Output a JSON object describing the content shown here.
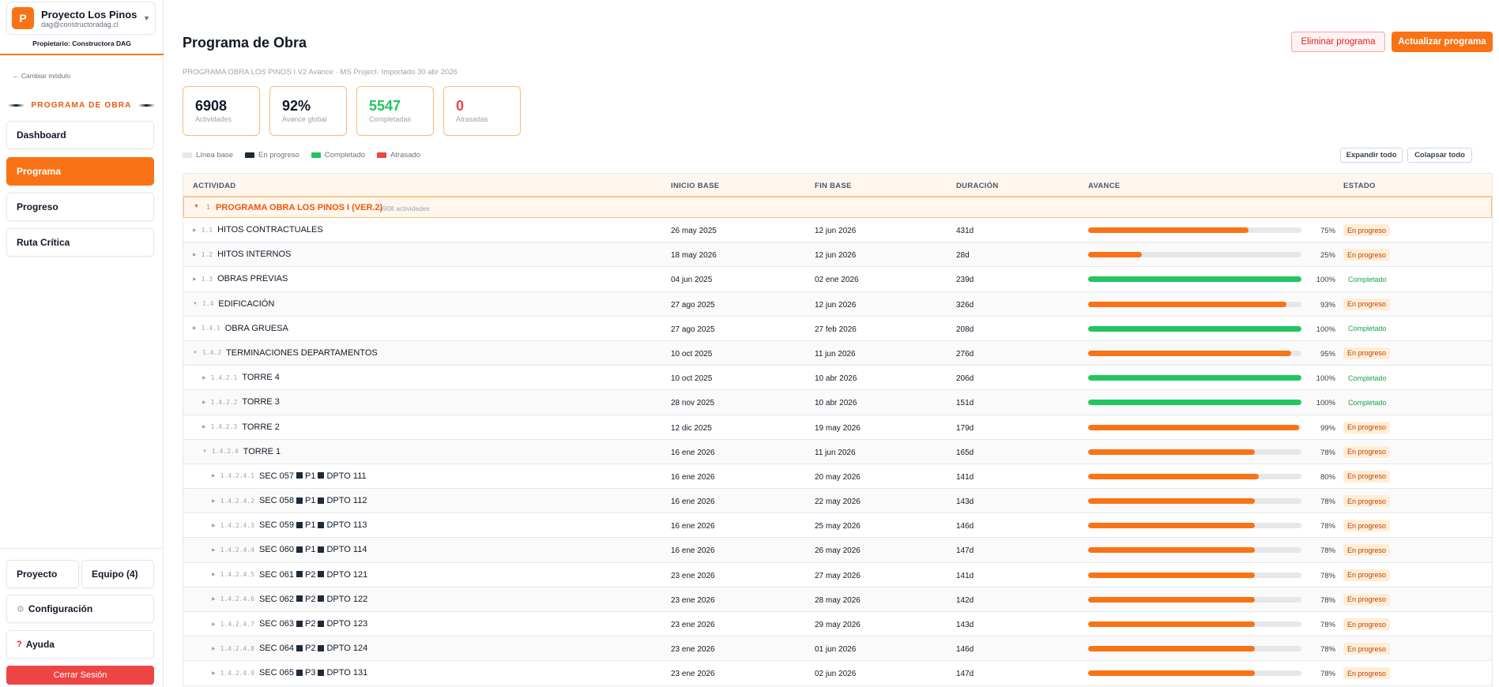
{
  "sidebar": {
    "project_initial": "P",
    "project_name": "Proyecto Los Pinos",
    "project_email": "dag@constructoradag.cl",
    "owner": "Propietario: Constructora DAG",
    "change_module": "← Cambiar módulo",
    "module_title": "PROGRAMA DE OBRA",
    "nav": [
      "Dashboard",
      "Programa",
      "Progreso",
      "Ruta Crítica"
    ],
    "proyecto": "Proyecto",
    "equipo": "Equipo (4)",
    "config": "Configuración",
    "ayuda": "Ayuda",
    "logout": "Cerrar Sesión"
  },
  "header": {
    "title": "Programa de Obra",
    "delete_btn": "Eliminar programa",
    "update_btn": "Actualizar programa",
    "subtitle": "PROGRAMA OBRA LOS PINOS I V2 Avance · MS Project· Importado 30 abr 2026"
  },
  "stats": [
    {
      "value": "6908",
      "label": "Actividades"
    },
    {
      "value": "92%",
      "label": "Avance global"
    },
    {
      "value": "5547",
      "label": "Completadas"
    },
    {
      "value": "0",
      "label": "Atrasadas"
    }
  ],
  "legend": [
    {
      "label": "Línea base",
      "color": "#e5e7eb"
    },
    {
      "label": "En progreso",
      "color": "#1e293b"
    },
    {
      "label": "Completado",
      "color": "#22c55e"
    },
    {
      "label": "Atrasado",
      "color": "#ef4444"
    }
  ],
  "controls": {
    "expand": "Expandir todo",
    "collapse": "Colapsar todo"
  },
  "table": {
    "headers": [
      "ACTIVIDAD",
      "INICIO BASE",
      "FIN BASE",
      "DURACIÓN",
      "AVANCE",
      "ESTADO"
    ],
    "group": {
      "num": "1",
      "name": "PROGRAMA OBRA LOS PINOS I (VER.2)",
      "count": "6908 actividades"
    },
    "rows": [
      {
        "num": "1.1",
        "name": "HITOS CONTRACTUALES",
        "start": "26 may 2025",
        "end": "12 jun 2026",
        "dur": "431d",
        "pct": 75,
        "pct_label": "75%",
        "status": "En progreso",
        "level": 0,
        "expanded": false
      },
      {
        "num": "1.2",
        "name": "HITOS INTERNOS",
        "start": "18 may 2026",
        "end": "12 jun 2026",
        "dur": "28d",
        "pct": 25,
        "pct_label": "25%",
        "status": "En progreso",
        "level": 0,
        "expanded": false
      },
      {
        "num": "1.3",
        "name": "OBRAS PREVIAS",
        "start": "04 jun 2025",
        "end": "02 ene 2026",
        "dur": "239d",
        "pct": 100,
        "pct_label": "100%",
        "status": "Completado",
        "level": 0,
        "expanded": false
      },
      {
        "num": "1.4",
        "name": "EDIFICACIÓN",
        "start": "27 ago 2025",
        "end": "12 jun 2026",
        "dur": "326d",
        "pct": 93,
        "pct_label": "93%",
        "status": "En progreso",
        "level": 0,
        "expanded": true
      },
      {
        "num": "1.4.1",
        "name": "OBRA GRUESA",
        "start": "27 ago 2025",
        "end": "27 feb 2026",
        "dur": "208d",
        "pct": 100,
        "pct_label": "100%",
        "status": "Completado",
        "level": 1,
        "expanded": false
      },
      {
        "num": "1.4.2",
        "name": "TERMINACIONES DEPARTAMENTOS",
        "start": "10 oct 2025",
        "end": "11 jun 2026",
        "dur": "276d",
        "pct": 95,
        "pct_label": "95%",
        "status": "En progreso",
        "level": 1,
        "expanded": true
      },
      {
        "num": "1.4.2.1",
        "name": "TORRE 4",
        "start": "10 oct 2025",
        "end": "10 abr 2026",
        "dur": "206d",
        "pct": 100,
        "pct_label": "100%",
        "status": "Completado",
        "level": 2,
        "expanded": false
      },
      {
        "num": "1.4.2.2",
        "name": "TORRE 3",
        "start": "28 nov 2025",
        "end": "10 abr 2026",
        "dur": "151d",
        "pct": 100,
        "pct_label": "100%",
        "status": "Completado",
        "level": 2,
        "expanded": false
      },
      {
        "num": "1.4.2.3",
        "name": "TORRE 2",
        "start": "12 dic 2025",
        "end": "19 may 2026",
        "dur": "179d",
        "pct": 99,
        "pct_label": "99%",
        "status": "En progreso",
        "level": 2,
        "expanded": false
      },
      {
        "num": "1.4.2.4",
        "name": "TORRE 1",
        "start": "16 ene 2026",
        "end": "11 jun 2026",
        "dur": "165d",
        "pct": 78,
        "pct_label": "78%",
        "status": "En progreso",
        "level": 2,
        "expanded": true
      },
      {
        "num": "1.4.2.4.1",
        "name": [
          "SEC 057",
          "P1",
          "DPTO 111"
        ],
        "start": "16 ene 2026",
        "end": "20 may 2026",
        "dur": "141d",
        "pct": 80,
        "pct_label": "80%",
        "status": "En progreso",
        "level": 3,
        "expanded": false
      },
      {
        "num": "1.4.2.4.2",
        "name": [
          "SEC 058",
          "P1",
          "DPTO 112"
        ],
        "start": "16 ene 2026",
        "end": "22 may 2026",
        "dur": "143d",
        "pct": 78,
        "pct_label": "78%",
        "status": "En progreso",
        "level": 3,
        "expanded": false
      },
      {
        "num": "1.4.2.4.3",
        "name": [
          "SEC 059",
          "P1",
          "DPTO 113"
        ],
        "start": "16 ene 2026",
        "end": "25 may 2026",
        "dur": "146d",
        "pct": 78,
        "pct_label": "78%",
        "status": "En progreso",
        "level": 3,
        "expanded": false
      },
      {
        "num": "1.4.2.4.4",
        "name": [
          "SEC 060",
          "P1",
          "DPTO 114"
        ],
        "start": "16 ene 2026",
        "end": "26 may 2026",
        "dur": "147d",
        "pct": 78,
        "pct_label": "78%",
        "status": "En progreso",
        "level": 3,
        "expanded": false
      },
      {
        "num": "1.4.2.4.5",
        "name": [
          "SEC 061",
          "P2",
          "DPTO 121"
        ],
        "start": "23 ene 2026",
        "end": "27 may 2026",
        "dur": "141d",
        "pct": 78,
        "pct_label": "78%",
        "status": "En progreso",
        "level": 3,
        "expanded": false
      },
      {
        "num": "1.4.2.4.6",
        "name": [
          "SEC 062",
          "P2",
          "DPTO 122"
        ],
        "start": "23 ene 2026",
        "end": "28 may 2026",
        "dur": "142d",
        "pct": 78,
        "pct_label": "78%",
        "status": "En progreso",
        "level": 3,
        "expanded": false
      },
      {
        "num": "1.4.2.4.7",
        "name": [
          "SEC 063",
          "P2",
          "DPTO 123"
        ],
        "start": "23 ene 2026",
        "end": "29 may 2026",
        "dur": "143d",
        "pct": 78,
        "pct_label": "78%",
        "status": "En progreso",
        "level": 3,
        "expanded": false
      },
      {
        "num": "1.4.2.4.8",
        "name": [
          "SEC 064",
          "P2",
          "DPTO 124"
        ],
        "start": "23 ene 2026",
        "end": "01 jun 2026",
        "dur": "146d",
        "pct": 78,
        "pct_label": "78%",
        "status": "En progreso",
        "level": 3,
        "expanded": false
      },
      {
        "num": "1.4.2.4.9",
        "name": [
          "SEC 065",
          "P3",
          "DPTO 131"
        ],
        "start": "23 ene 2026",
        "end": "02 jun 2026",
        "dur": "147d",
        "pct": 78,
        "pct_label": "78%",
        "status": "En progreso",
        "level": 3,
        "expanded": false
      }
    ]
  },
  "colors": {
    "accent": "#f97316",
    "progress": "#f97316",
    "done": "#22c55e",
    "danger": "#ef4444"
  }
}
